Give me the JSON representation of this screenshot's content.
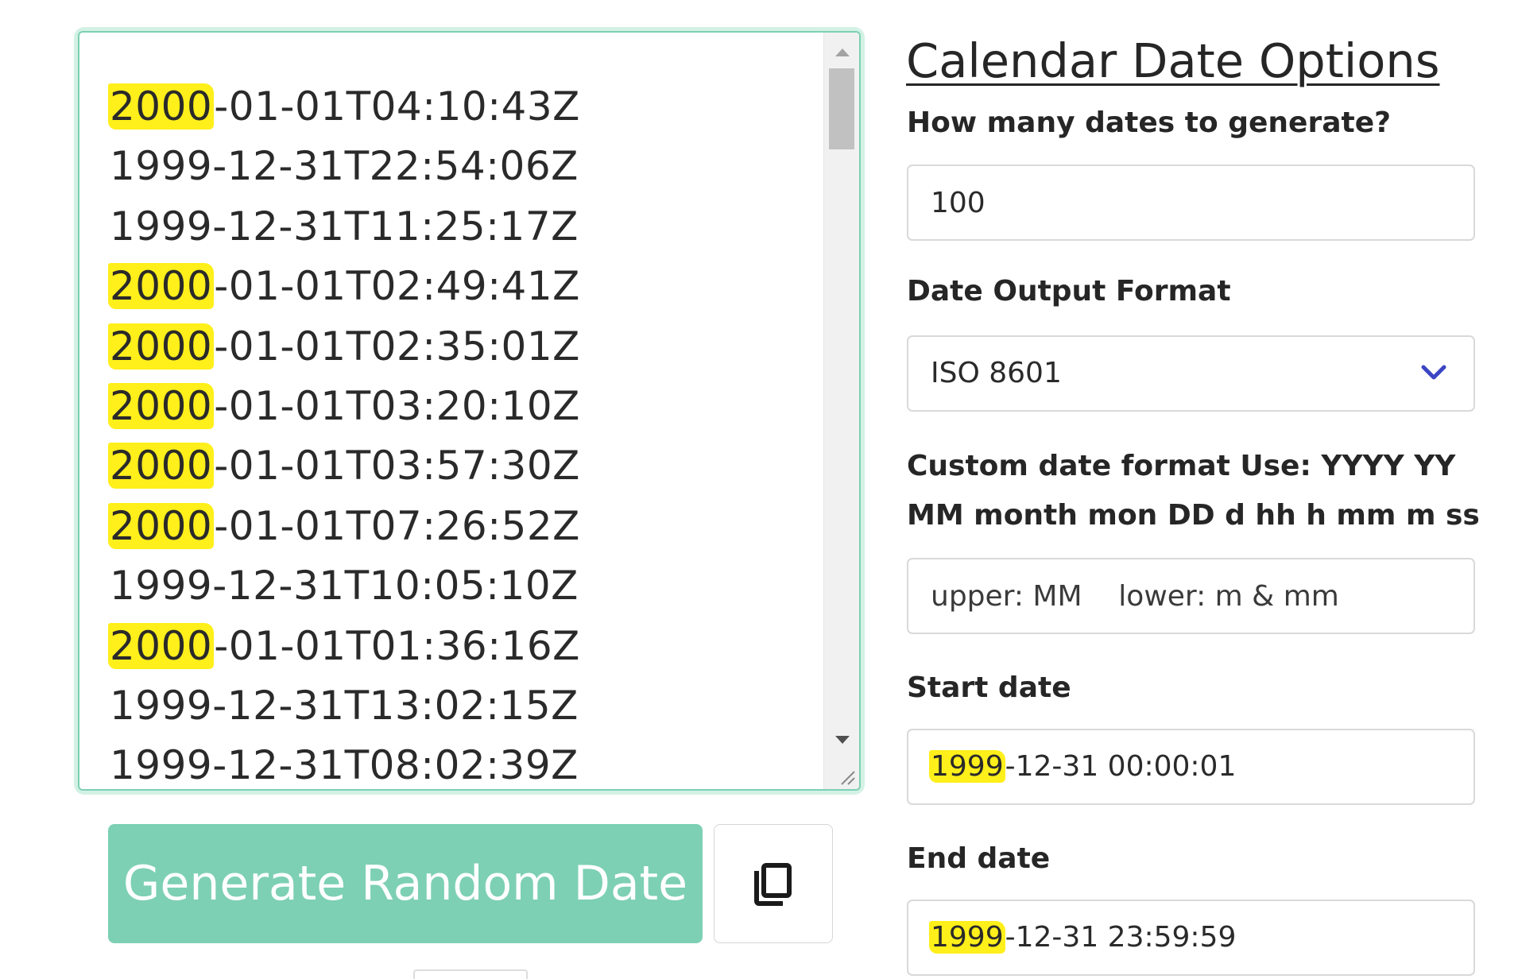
{
  "output": {
    "lines": [
      {
        "year": "2000",
        "rest": "-01-01T04:10:43Z",
        "highlight": true
      },
      {
        "year": "1999",
        "rest": "-12-31T22:54:06Z",
        "highlight": false
      },
      {
        "year": "1999",
        "rest": "-12-31T11:25:17Z",
        "highlight": false
      },
      {
        "year": "2000",
        "rest": "-01-01T02:49:41Z",
        "highlight": true
      },
      {
        "year": "2000",
        "rest": "-01-01T02:35:01Z",
        "highlight": true
      },
      {
        "year": "2000",
        "rest": "-01-01T03:20:10Z",
        "highlight": true
      },
      {
        "year": "2000",
        "rest": "-01-01T03:57:30Z",
        "highlight": true
      },
      {
        "year": "2000",
        "rest": "-01-01T07:26:52Z",
        "highlight": true
      },
      {
        "year": "1999",
        "rest": "-12-31T10:05:10Z",
        "highlight": false
      },
      {
        "year": "2000",
        "rest": "-01-01T01:36:16Z",
        "highlight": true
      },
      {
        "year": "1999",
        "rest": "-12-31T13:02:15Z",
        "highlight": false
      },
      {
        "year": "1999",
        "rest": "-12-31T08:02:39Z",
        "highlight": false
      }
    ],
    "highlight_color": "#ffef1a"
  },
  "buttons": {
    "generate_label": "Generate Random Date",
    "generate_color": "#7dd0b3",
    "copy_icon": "copy-icon"
  },
  "panel": {
    "title": "Calendar Date Options",
    "count": {
      "label": "How many dates to generate?",
      "value": "100"
    },
    "format": {
      "label": "Date Output Format",
      "selected": "ISO 8601",
      "icon": "chevron-down-icon",
      "icon_color": "#3b45c4"
    },
    "custom_format": {
      "label": "Custom date format Use: YYYY YY MM month mon DD d hh h mm m ss s",
      "placeholder": "upper: MM    lower: m & mm"
    },
    "start_date": {
      "label": "Start date",
      "year": "1999",
      "rest": "-12-31 00:00:01"
    },
    "end_date": {
      "label": "End date",
      "year": "1999",
      "rest": "-12-31 23:59:59"
    }
  }
}
